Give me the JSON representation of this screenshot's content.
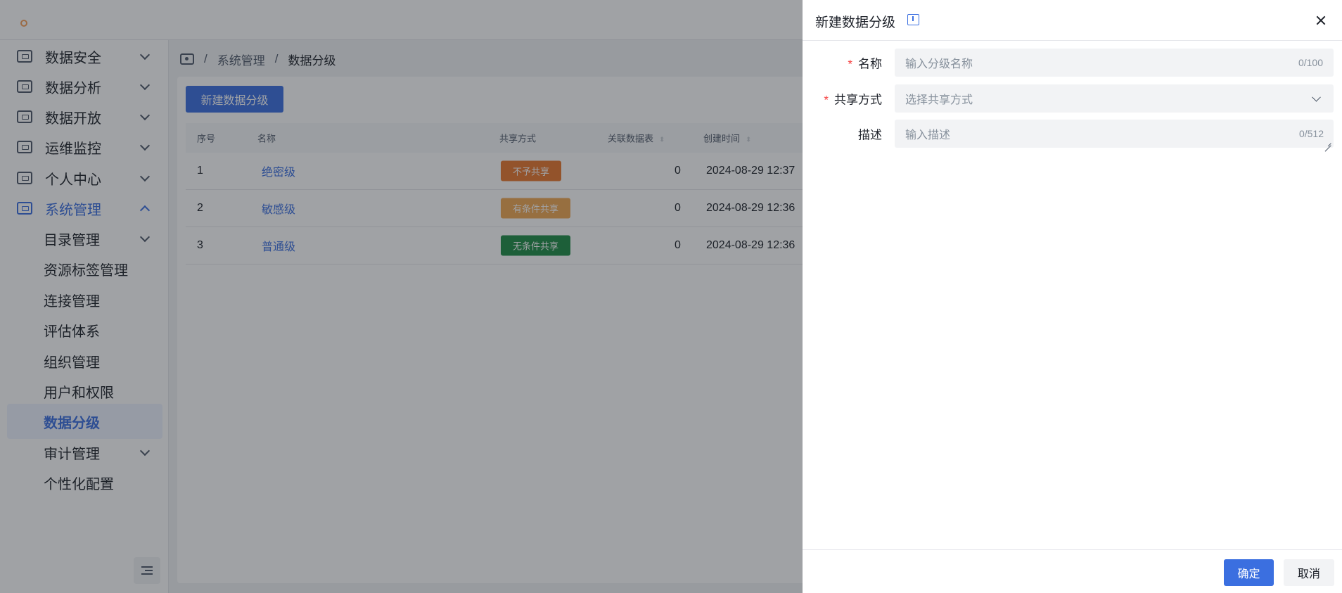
{
  "sidebar": {
    "items": [
      {
        "label": "数据安全",
        "icon": "shield-check-icon"
      },
      {
        "label": "数据分析",
        "icon": "analysis-icon"
      },
      {
        "label": "数据开放",
        "icon": "open-data-icon"
      },
      {
        "label": "运维监控",
        "icon": "monitor-chart-icon"
      },
      {
        "label": "个人中心",
        "icon": "user-icon"
      },
      {
        "label": "系统管理",
        "icon": "settings-screen-icon"
      }
    ],
    "sub_items": [
      {
        "label": "目录管理"
      },
      {
        "label": "资源标签管理"
      },
      {
        "label": "连接管理"
      },
      {
        "label": "评估体系"
      },
      {
        "label": "组织管理"
      },
      {
        "label": "用户和权限"
      },
      {
        "label": "数据分级"
      },
      {
        "label": "审计管理"
      },
      {
        "label": "个性化配置"
      }
    ]
  },
  "breadcrumb": {
    "separator": "/",
    "items": [
      "系统管理",
      "数据分级"
    ]
  },
  "toolbar": {
    "new_button": "新建数据分级"
  },
  "table": {
    "headers": {
      "index": "序号",
      "name": "名称",
      "share": "共享方式",
      "related": "关联数据表",
      "created": "创建时间"
    },
    "rows": [
      {
        "index": "1",
        "name": "绝密级",
        "share": "不予共享",
        "share_color": "#e8772e",
        "related": "0",
        "created": "2024-08-29 12:37"
      },
      {
        "index": "2",
        "name": "敏感级",
        "share": "有条件共享",
        "share_color": "#f0a752",
        "related": "0",
        "created": "2024-08-29 12:36"
      },
      {
        "index": "3",
        "name": "普通级",
        "share": "无条件共享",
        "share_color": "#1e8c45",
        "related": "0",
        "created": "2024-08-29 12:36"
      }
    ]
  },
  "drawer": {
    "title": "新建数据分级",
    "fields": {
      "name": {
        "label": "名称",
        "required_mark": "*",
        "placeholder": "输入分级名称",
        "count": "0/100"
      },
      "share": {
        "label": "共享方式",
        "required_mark": "*",
        "placeholder": "选择共享方式"
      },
      "desc": {
        "label": "描述",
        "placeholder": "输入描述",
        "count": "0/512"
      }
    },
    "ok": "确定",
    "cancel": "取消"
  },
  "colors": {
    "primary": "#3b6fe0",
    "required": "#f53f3f",
    "mask": "rgba(29,33,41,0.42)"
  }
}
